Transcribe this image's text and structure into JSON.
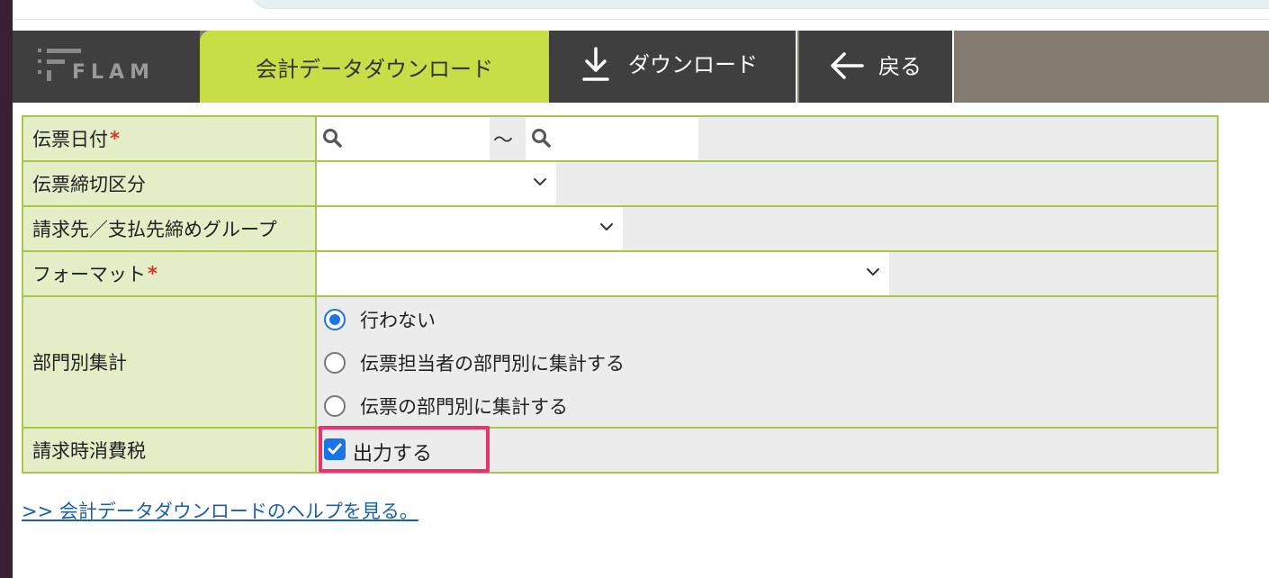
{
  "header": {
    "logo_text": "FLAM",
    "active_tab": "会計データダウンロード",
    "download_label": "ダウンロード",
    "back_label": "戻る"
  },
  "form": {
    "date": {
      "label": "伝票日付",
      "required_mark": "*",
      "range_sep": "〜"
    },
    "closing": {
      "label": "伝票締切区分"
    },
    "billing_group": {
      "label": "請求先／支払先締めグループ"
    },
    "format": {
      "label": "フォーマット",
      "required_mark": "*"
    },
    "department": {
      "label": "部門別集計",
      "options": [
        "行わない",
        "伝票担当者の部門別に集計する",
        "伝票の部門別に集計する"
      ],
      "selected_index": 0
    },
    "tax": {
      "label": "請求時消費税",
      "checkbox_label": "出力する",
      "checked": true
    }
  },
  "help_link": ">> 会計データダウンロードのヘルプを見る。",
  "colors": {
    "accent": "#c9dd47",
    "header_dark": "#3f3f3f",
    "label_bg": "#e4edc6",
    "border": "#a8c64a",
    "highlight": "#e8336d"
  }
}
